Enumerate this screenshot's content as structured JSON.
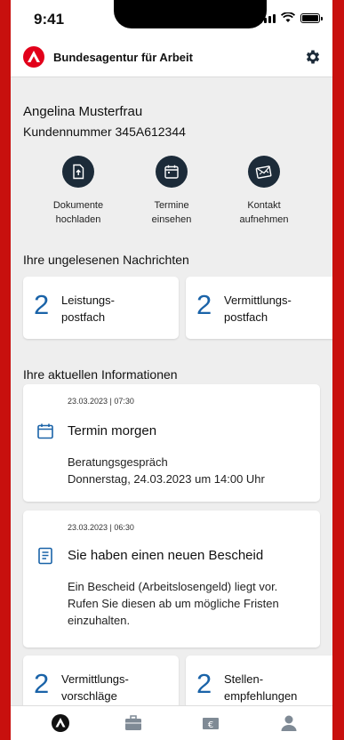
{
  "status": {
    "time": "9:41"
  },
  "app": {
    "name": "Bundesagentur für Arbeit"
  },
  "user": {
    "name": "Angelina Musterfrau",
    "kundennummer": "Kundennummer 345A612344"
  },
  "actions": [
    {
      "line1": "Dokumente",
      "line2": "hochladen",
      "icon": "upload-document-icon"
    },
    {
      "line1": "Termine",
      "line2": "einsehen",
      "icon": "calendar-icon"
    },
    {
      "line1": "Kontakt",
      "line2": "aufnehmen",
      "icon": "mail-contact-icon"
    }
  ],
  "unread": {
    "title": "Ihre ungelesenen Nachrichten",
    "items": [
      {
        "count": "2",
        "line1": "Leistungs-",
        "line2": "postfach"
      },
      {
        "count": "2",
        "line1": "Vermittlungs-",
        "line2": "postfach"
      }
    ]
  },
  "info": {
    "title": "Ihre aktuellen Informationen",
    "cards": [
      {
        "timestamp": "23.03.2023 | 07:30",
        "icon": "calendar-icon",
        "title": "Termin morgen",
        "line1": "Beratungsgespräch",
        "line2": "Donnerstag, 24.03.2023 um 14:00 Uhr"
      },
      {
        "timestamp": "23.03.2023 | 06:30",
        "icon": "document-icon",
        "title": "Sie haben einen neuen Bescheid",
        "line1": "Ein Bescheid (Arbeitslosengeld) liegt vor.",
        "line2": "Rufen Sie diesen ab um mögliche Fristen",
        "line3": "einzuhalten."
      }
    ]
  },
  "bottom_cards": [
    {
      "count": "2",
      "line1": "Vermittlungs-",
      "line2": "vorschläge"
    },
    {
      "count": "2",
      "line1": "Stellen-",
      "line2": "empfehlungen"
    }
  ],
  "nav": [
    "home-icon",
    "briefcase-icon",
    "euro-icon",
    "profile-icon"
  ],
  "colors": {
    "brand_red": "#c8100e",
    "accent_blue": "#1a63a8",
    "dark_icon": "#1c2b39"
  }
}
